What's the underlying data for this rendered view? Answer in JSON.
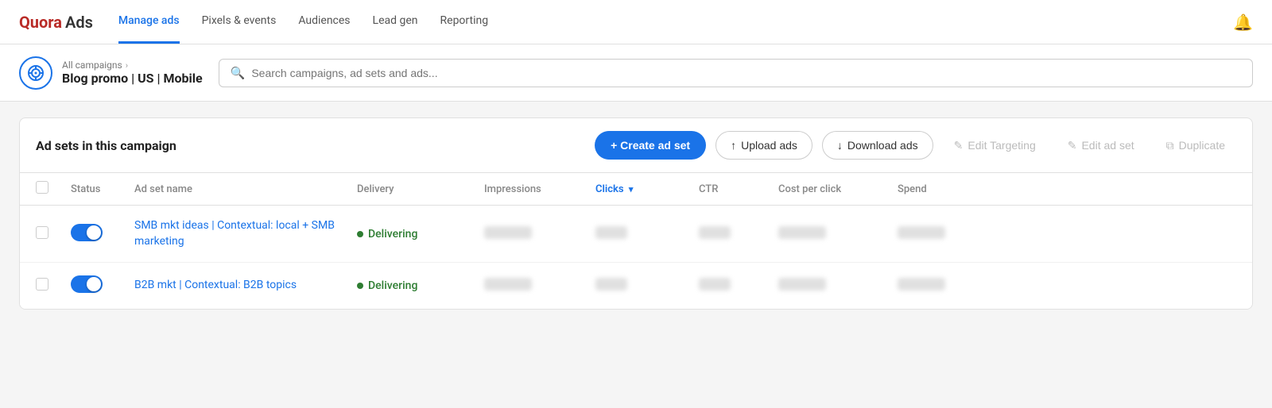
{
  "logo": {
    "quora": "Quora",
    "ads": "Ads"
  },
  "nav": {
    "links": [
      {
        "label": "Manage ads",
        "active": true
      },
      {
        "label": "Pixels & events",
        "active": false
      },
      {
        "label": "Audiences",
        "active": false
      },
      {
        "label": "Lead gen",
        "active": false
      },
      {
        "label": "Reporting",
        "active": false
      }
    ]
  },
  "breadcrumb": {
    "parent": "All campaigns",
    "current": "Blog promo | US | Mobile"
  },
  "search": {
    "placeholder": "Search campaigns, ad sets and ads..."
  },
  "panel": {
    "title": "Ad sets in this campaign",
    "create_btn": "+ Create ad set",
    "upload_btn": "Upload ads",
    "download_btn": "Download ads",
    "edit_targeting_btn": "Edit Targeting",
    "edit_adset_btn": "Edit ad set",
    "duplicate_btn": "Duplicate"
  },
  "table": {
    "columns": [
      {
        "label": "",
        "key": "checkbox"
      },
      {
        "label": "Status",
        "key": "status"
      },
      {
        "label": "Ad set name",
        "key": "name"
      },
      {
        "label": "Delivery",
        "key": "delivery"
      },
      {
        "label": "Impressions",
        "key": "impressions"
      },
      {
        "label": "Clicks",
        "key": "clicks",
        "active": true,
        "sortable": true
      },
      {
        "label": "CTR",
        "key": "ctr"
      },
      {
        "label": "Cost per click",
        "key": "cpc"
      },
      {
        "label": "Spend",
        "key": "spend"
      }
    ],
    "rows": [
      {
        "name": "SMB mkt ideas | Contextual: local + SMB marketing",
        "delivery": "Delivering",
        "toggle": true
      },
      {
        "name": "B2B mkt | Contextual: B2B topics",
        "delivery": "Delivering",
        "toggle": true
      }
    ]
  }
}
